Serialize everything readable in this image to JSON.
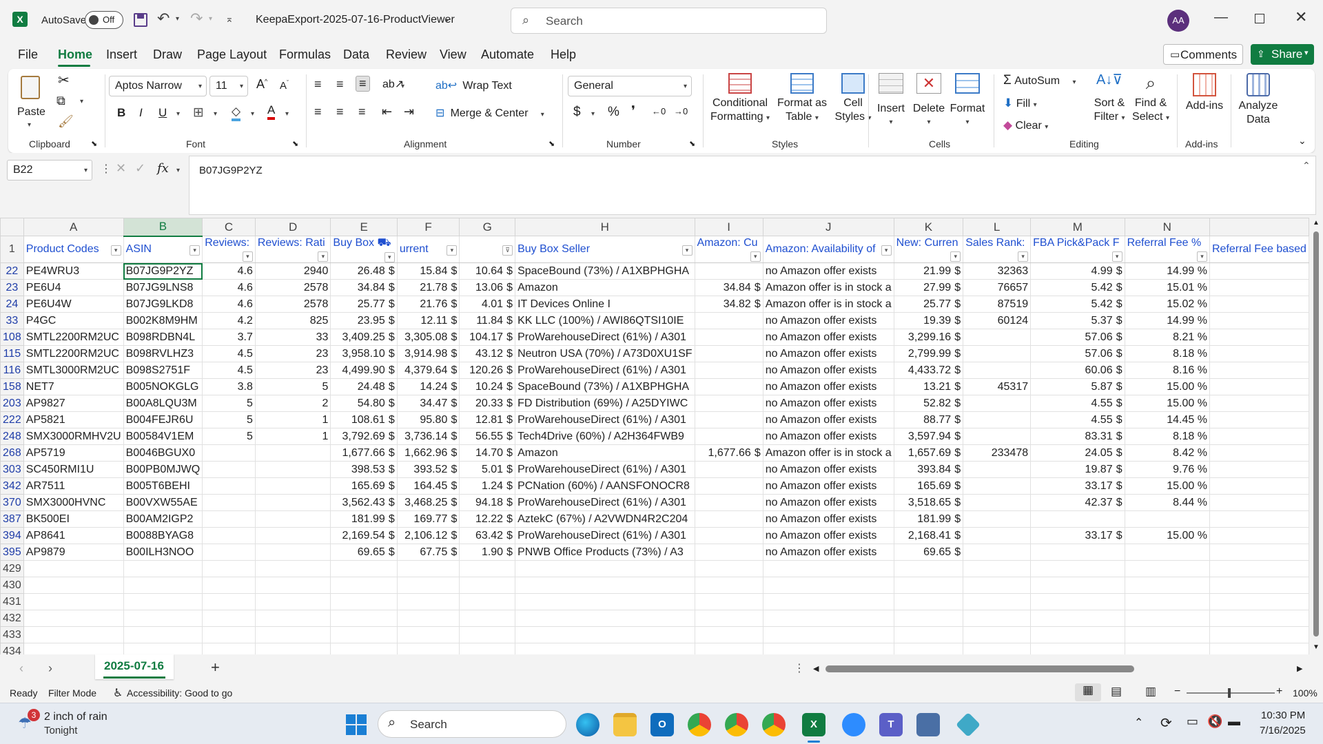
{
  "titlebar": {
    "autosave_label": "AutoSave",
    "autosave_state": "Off",
    "filename": "KeepaExport-2025-07-16-ProductViewer",
    "search_placeholder": "Search",
    "avatar_initials": "AA"
  },
  "menu": [
    "File",
    "Home",
    "Insert",
    "Draw",
    "Page Layout",
    "Formulas",
    "Data",
    "Review",
    "View",
    "Automate",
    "Help"
  ],
  "menu_active": "Home",
  "comments_label": "Comments",
  "share_label": "Share",
  "ribbon": {
    "clipboard": {
      "paste": "Paste",
      "label": "Clipboard"
    },
    "font": {
      "name": "Aptos Narrow",
      "size": "11",
      "label": "Font"
    },
    "alignment": {
      "wrap": "Wrap Text",
      "merge": "Merge & Center",
      "label": "Alignment"
    },
    "number": {
      "format": "General",
      "label": "Number"
    },
    "styles": {
      "cond1": "Conditional",
      "cond2": "Formatting",
      "fat1": "Format as",
      "fat2": "Table",
      "cs1": "Cell",
      "cs2": "Styles",
      "label": "Styles"
    },
    "cells": {
      "insert": "Insert",
      "delete": "Delete",
      "format": "Format",
      "label": "Cells"
    },
    "editing": {
      "autosum": "AutoSum",
      "fill": "Fill",
      "clear": "Clear",
      "sort1": "Sort &",
      "sort2": "Filter",
      "find1": "Find &",
      "find2": "Select",
      "label": "Editing"
    },
    "addins": {
      "addins": "Add-ins",
      "label": "Add-ins"
    },
    "analyze": {
      "l1": "Analyze",
      "l2": "Data"
    }
  },
  "formula_bar": {
    "name_box": "B22",
    "fx": "fx",
    "formula": "B07JG9P2YZ"
  },
  "columns": [
    "A",
    "B",
    "C",
    "D",
    "E",
    "F",
    "G",
    "H",
    "I",
    "J",
    "K",
    "L",
    "M",
    "N"
  ],
  "header_row": {
    "row_num": "1",
    "cells": [
      "Product Codes",
      "ASIN",
      "Reviews:",
      "Reviews: Rati",
      "Buy Box",
      "urrent",
      "",
      "Buy Box Seller",
      "Amazon: Cu",
      "Amazon: Availability of",
      "New: Curren",
      "Sales Rank:",
      "FBA Pick&Pack F",
      "Referral Fee %",
      "Referral Fee based"
    ]
  },
  "rows": [
    {
      "n": "22",
      "a": "PE4WRU3",
      "b": "B07JG9P2YZ",
      "c": "4.6",
      "d": "2940",
      "e": "26.48",
      "f": "15.84",
      "g": "10.64",
      "h": "SpaceBound (73%) / A1XBPHGHA",
      "i": "",
      "j": "no Amazon offer exists",
      "k": "21.99",
      "l": "32363",
      "m": "4.99",
      "nn": "14.99 %"
    },
    {
      "n": "23",
      "a": "PE6U4",
      "b": "B07JG9LNS8",
      "c": "4.6",
      "d": "2578",
      "e": "34.84",
      "f": "21.78",
      "g": "13.06",
      "h": "Amazon",
      "i": "34.84",
      "j": "Amazon offer is in stock a",
      "k": "27.99",
      "l": "76657",
      "m": "5.42",
      "nn": "15.01 %"
    },
    {
      "n": "24",
      "a": "PE6U4W",
      "b": "B07JG9LKD8",
      "c": "4.6",
      "d": "2578",
      "e": "25.77",
      "f": "21.76",
      "g": "4.01",
      "h": "IT Devices Online I",
      "i": "34.82",
      "j": "Amazon offer is in stock a",
      "k": "25.77",
      "l": "87519",
      "m": "5.42",
      "nn": "15.02 %"
    },
    {
      "n": "33",
      "a": "P4GC",
      "b": "B002K8M9HM",
      "c": "4.2",
      "d": "825",
      "e": "23.95",
      "f": "12.11",
      "g": "11.84",
      "h": "KK LLC (100%) / AWI86QTSI10IE",
      "i": "",
      "j": "no Amazon offer exists",
      "k": "19.39",
      "l": "60124",
      "m": "5.37",
      "nn": "14.99 %"
    },
    {
      "n": "108",
      "a": "SMTL2200RM2UC",
      "b": "B098RDBN4L",
      "c": "3.7",
      "d": "33",
      "e": "3,409.25",
      "f": "3,305.08",
      "g": "104.17",
      "h": "ProWarehouseDirect (61%) / A301",
      "i": "",
      "j": "no Amazon offer exists",
      "k": "3,299.16",
      "l": "",
      "m": "57.06",
      "nn": "8.21 %"
    },
    {
      "n": "115",
      "a": "SMTL2200RM2UC",
      "b": "B098RVLHZ3",
      "c": "4.5",
      "d": "23",
      "e": "3,958.10",
      "f": "3,914.98",
      "g": "43.12",
      "h": "Neutron USA (70%) / A73D0XU1SF",
      "i": "",
      "j": "no Amazon offer exists",
      "k": "2,799.99",
      "l": "",
      "m": "57.06",
      "nn": "8.18 %"
    },
    {
      "n": "116",
      "a": "SMTL3000RM2UC",
      "b": "B098S2751F",
      "c": "4.5",
      "d": "23",
      "e": "4,499.90",
      "f": "4,379.64",
      "g": "120.26",
      "h": "ProWarehouseDirect (61%) / A301",
      "i": "",
      "j": "no Amazon offer exists",
      "k": "4,433.72",
      "l": "",
      "m": "60.06",
      "nn": "8.16 %"
    },
    {
      "n": "158",
      "a": "NET7",
      "b": "B005NOKGLG",
      "c": "3.8",
      "d": "5",
      "e": "24.48",
      "f": "14.24",
      "g": "10.24",
      "h": "SpaceBound (73%) / A1XBPHGHA",
      "i": "",
      "j": "no Amazon offer exists",
      "k": "13.21",
      "l": "45317",
      "m": "5.87",
      "nn": "15.00 %"
    },
    {
      "n": "203",
      "a": "AP9827",
      "b": "B00A8LQU3M",
      "c": "5",
      "d": "2",
      "e": "54.80",
      "f": "34.47",
      "g": "20.33",
      "h": "FD Distribution (69%) / A25DYIWC",
      "i": "",
      "j": "no Amazon offer exists",
      "k": "52.82",
      "l": "",
      "m": "4.55",
      "nn": "15.00 %"
    },
    {
      "n": "222",
      "a": "AP5821",
      "b": "B004FEJR6U",
      "c": "5",
      "d": "1",
      "e": "108.61",
      "f": "95.80",
      "g": "12.81",
      "h": "ProWarehouseDirect (61%) / A301",
      "i": "",
      "j": "no Amazon offer exists",
      "k": "88.77",
      "l": "",
      "m": "4.55",
      "nn": "14.45 %"
    },
    {
      "n": "248",
      "a": "SMX3000RMHV2U",
      "b": "B00584V1EM",
      "c": "5",
      "d": "1",
      "e": "3,792.69",
      "f": "3,736.14",
      "g": "56.55",
      "h": "Tech4Drive (60%) / A2H364FWB9",
      "i": "",
      "j": "no Amazon offer exists",
      "k": "3,597.94",
      "l": "",
      "m": "83.31",
      "nn": "8.18 %"
    },
    {
      "n": "268",
      "a": "AP5719",
      "b": "B0046BGUX0",
      "c": "",
      "d": "",
      "e": "1,677.66",
      "f": "1,662.96",
      "g": "14.70",
      "h": "Amazon",
      "i": "1,677.66",
      "j": "Amazon offer is in stock a",
      "k": "1,657.69",
      "l": "233478",
      "m": "24.05",
      "nn": "8.42 %"
    },
    {
      "n": "303",
      "a": "SC450RMI1U",
      "b": "B00PB0MJWQ",
      "c": "",
      "d": "",
      "e": "398.53",
      "f": "393.52",
      "g": "5.01",
      "h": "ProWarehouseDirect (61%) / A301",
      "i": "",
      "j": "no Amazon offer exists",
      "k": "393.84",
      "l": "",
      "m": "19.87",
      "nn": "9.76 %"
    },
    {
      "n": "342",
      "a": "AR7511",
      "b": "B005T6BEHI",
      "c": "",
      "d": "",
      "e": "165.69",
      "f": "164.45",
      "g": "1.24",
      "h": "PCNation (60%) / AANSFONOCR8",
      "i": "",
      "j": "no Amazon offer exists",
      "k": "165.69",
      "l": "",
      "m": "33.17",
      "nn": "15.00 %"
    },
    {
      "n": "370",
      "a": "SMX3000HVNC",
      "b": "B00VXW55AE",
      "c": "",
      "d": "",
      "e": "3,562.43",
      "f": "3,468.25",
      "g": "94.18",
      "h": "ProWarehouseDirect (61%) / A301",
      "i": "",
      "j": "no Amazon offer exists",
      "k": "3,518.65",
      "l": "",
      "m": "42.37",
      "nn": "8.44 %"
    },
    {
      "n": "387",
      "a": "BK500EI",
      "b": "B00AM2IGP2",
      "c": "",
      "d": "",
      "e": "181.99",
      "f": "169.77",
      "g": "12.22",
      "h": "AztekC (67%) / A2VWDN4R2C204",
      "i": "",
      "j": "no Amazon offer exists",
      "k": "181.99",
      "l": "",
      "m": "",
      "nn": ""
    },
    {
      "n": "394",
      "a": "AP8641",
      "b": "B0088BYAG8",
      "c": "",
      "d": "",
      "e": "2,169.54",
      "f": "2,106.12",
      "g": "63.42",
      "h": "ProWarehouseDirect (61%) / A301",
      "i": "",
      "j": "no Amazon offer exists",
      "k": "2,168.41",
      "l": "",
      "m": "33.17",
      "nn": "15.00 %"
    },
    {
      "n": "395",
      "a": "AP9879",
      "b": "B00ILH3NOO",
      "c": "",
      "d": "",
      "e": "69.65",
      "f": "67.75",
      "g": "1.90",
      "h": "PNWB Office Products (73%) / A3",
      "i": "",
      "j": "no Amazon offer exists",
      "k": "69.65",
      "l": "",
      "m": "",
      "nn": ""
    }
  ],
  "empty_rows": [
    "429",
    "430",
    "431",
    "432",
    "433",
    "434"
  ],
  "dollar_sign": "$",
  "sheet_tab": "2025-07-16",
  "status": {
    "ready": "Ready",
    "filter": "Filter Mode",
    "accessibility": "Accessibility: Good to go",
    "zoom": "100%"
  },
  "taskbar": {
    "weather_badge": "3",
    "weather1": "2 inch of rain",
    "weather2": "Tonight",
    "search": "Search",
    "time": "10:30 PM",
    "date": "7/16/2025"
  },
  "colors": {
    "excel_green": "#107c41",
    "header_blue": "#1f4fd0",
    "row_blue": "#1f3da8"
  }
}
